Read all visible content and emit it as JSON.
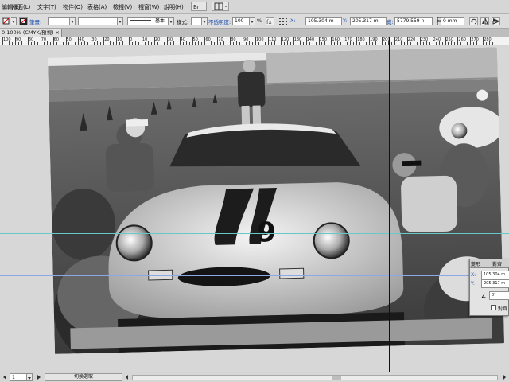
{
  "menu": {
    "items": [
      "編輯(E)",
      "版面(L)",
      "文字(T)",
      "物件(O)",
      "表格(A)",
      "檢視(V)",
      "視窗(W)",
      "說明(H)"
    ]
  },
  "control_bar": {
    "stroke_label": "筆畫:",
    "stroke_style_value": "基本",
    "style_label": "樣式:",
    "opacity_label": "不透明度:",
    "opacity_value": "100",
    "opacity_unit": "%",
    "x_label": "X:",
    "x_value": "105.304 m",
    "y_label": "Y:",
    "y_value": "205.317 m",
    "w_label": "寬:",
    "w_value": "5779.559 n",
    "h_value": "0 mm"
  },
  "tab": {
    "title": "0 100% (CMYK/預視)"
  },
  "ruler": {
    "labels": [
      "100",
      "90",
      "80",
      "70",
      "60",
      "50",
      "40",
      "30",
      "20",
      "10",
      "0",
      "10",
      "20",
      "30",
      "40",
      "50",
      "60",
      "70",
      "80",
      "90",
      "100",
      "110",
      "120",
      "130",
      "140",
      "150",
      "160",
      "170",
      "180",
      "190",
      "200",
      "210",
      "220",
      "230",
      "240",
      "250",
      "260",
      "270",
      "280"
    ]
  },
  "status": {
    "page_value": "1",
    "toggle_label": "切換選取"
  },
  "panel": {
    "tab1": "變形",
    "tab2": "對齊",
    "x_label": "X:",
    "x_value": "105.304 m",
    "y_label": "Y:",
    "y_value": "205.317 m",
    "angle_label": "∠",
    "angle_value": "0°",
    "checkbox_label": "對齊"
  },
  "photo": {
    "car_number": "9"
  }
}
